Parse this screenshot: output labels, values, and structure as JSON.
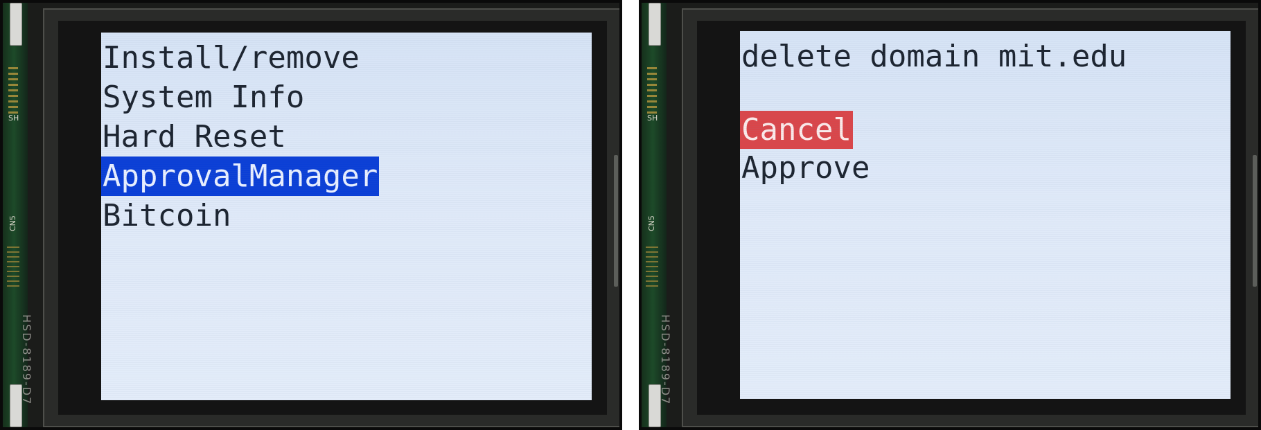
{
  "panels": {
    "left": {
      "menu_items": [
        "Install/remove",
        "System Info",
        "Hard Reset",
        "ApprovalManager",
        "Bitcoin"
      ],
      "selected_index": 3,
      "selection_color": "#0b3fd6",
      "silkscreen": {
        "sh": "SH",
        "cn5": "CN5",
        "model": "HSD-8189-D7"
      }
    },
    "right": {
      "prompt": "delete domain mit.edu",
      "choices": [
        "Cancel",
        "Approve"
      ],
      "highlighted_index": 0,
      "highlight_color": "#d9464a",
      "silkscreen": {
        "sh": "SH",
        "cn5": "CN5",
        "model": "HSD-8189-D7"
      }
    }
  }
}
